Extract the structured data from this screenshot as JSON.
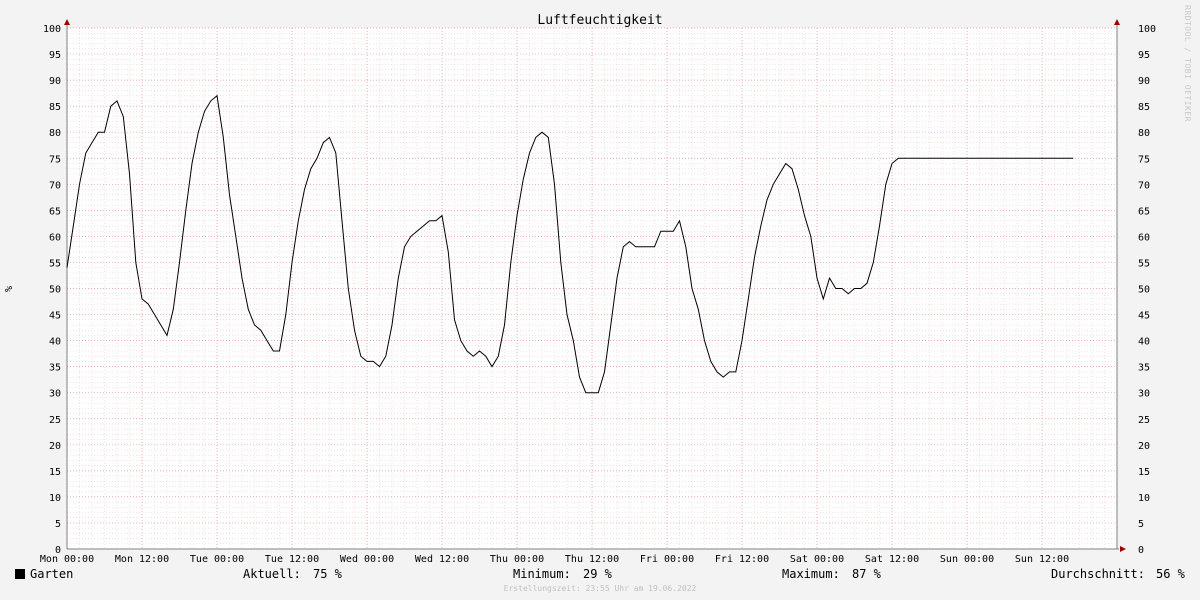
{
  "chart_data": {
    "type": "line",
    "title": "Luftfeuchtigkeit",
    "ylabel": "%",
    "ylim": [
      0,
      100
    ],
    "y_ticks": [
      0,
      5,
      10,
      15,
      20,
      25,
      30,
      35,
      40,
      45,
      50,
      55,
      60,
      65,
      70,
      75,
      80,
      85,
      90,
      95,
      100
    ],
    "x_tick_labels": [
      "Mon 00:00",
      "Mon 12:00",
      "Tue 00:00",
      "Tue 12:00",
      "Wed 00:00",
      "Wed 12:00",
      "Thu 00:00",
      "Thu 12:00",
      "Fri 00:00",
      "Fri 12:00",
      "Sat 00:00",
      "Sat 12:00",
      "Sun 00:00",
      "Sun 12:00"
    ],
    "xlim_hours": [
      0,
      168
    ],
    "grid": true,
    "series": [
      {
        "name": "Garten",
        "color": "#000000",
        "x_hours": [
          0,
          1,
          2,
          3,
          4,
          5,
          6,
          7,
          8,
          9,
          10,
          11,
          12,
          13,
          14,
          15,
          16,
          17,
          18,
          19,
          20,
          21,
          22,
          23,
          24,
          25,
          26,
          27,
          28,
          29,
          30,
          31,
          32,
          33,
          34,
          35,
          36,
          37,
          38,
          39,
          40,
          41,
          42,
          43,
          44,
          45,
          46,
          47,
          48,
          49,
          50,
          51,
          52,
          53,
          54,
          55,
          56,
          57,
          58,
          59,
          60,
          61,
          62,
          63,
          64,
          65,
          66,
          67,
          68,
          69,
          70,
          71,
          72,
          73,
          74,
          75,
          76,
          77,
          78,
          79,
          80,
          81,
          82,
          83,
          84,
          85,
          86,
          87,
          88,
          89,
          90,
          91,
          92,
          93,
          94,
          95,
          96,
          97,
          98,
          99,
          100,
          101,
          102,
          103,
          104,
          105,
          106,
          107,
          108,
          109,
          110,
          111,
          112,
          113,
          114,
          115,
          116,
          117,
          118,
          119,
          120,
          121,
          122,
          123,
          124,
          125,
          126,
          127,
          128,
          129,
          130,
          131,
          132,
          133,
          134,
          135,
          136,
          137,
          138,
          139,
          140,
          141,
          142,
          143,
          144,
          145,
          146,
          147,
          148,
          149,
          150,
          151,
          152,
          153,
          154,
          155,
          156,
          157,
          158,
          159,
          160,
          161,
          162,
          163,
          164,
          165,
          166,
          167,
          168
        ],
        "values": [
          54,
          62,
          70,
          76,
          78,
          80,
          80,
          85,
          86,
          83,
          72,
          55,
          48,
          47,
          45,
          43,
          41,
          46,
          55,
          65,
          74,
          80,
          84,
          86,
          87,
          79,
          68,
          60,
          52,
          46,
          43,
          42,
          40,
          38,
          38,
          45,
          55,
          63,
          69,
          73,
          75,
          78,
          79,
          76,
          63,
          50,
          42,
          37,
          36,
          36,
          35,
          37,
          43,
          52,
          58,
          60,
          61,
          62,
          63,
          63,
          64,
          57,
          44,
          40,
          38,
          37,
          38,
          37,
          35,
          37,
          43,
          55,
          64,
          71,
          76,
          79,
          80,
          79,
          70,
          55,
          45,
          40,
          33,
          30,
          30,
          30,
          34,
          43,
          52,
          58,
          59,
          58,
          58,
          58,
          58,
          61,
          61,
          61,
          63,
          58,
          50,
          46,
          40,
          36,
          34,
          33,
          34,
          34,
          40,
          48,
          56,
          62,
          67,
          70,
          72,
          74,
          73,
          69,
          64,
          60,
          52,
          48,
          52,
          50,
          50,
          49,
          50,
          50,
          51,
          55,
          62,
          70,
          74,
          75,
          75,
          75,
          75,
          75,
          75,
          75,
          75,
          75,
          75,
          75,
          75,
          75,
          75,
          75,
          75,
          75,
          75,
          75,
          75,
          75,
          75,
          75,
          75,
          75,
          75,
          75,
          75,
          75,
          75,
          75,
          75,
          75,
          75,
          75,
          75
        ]
      }
    ]
  },
  "legend": {
    "series_name": "Garten"
  },
  "stats": {
    "current_label": "Aktuell:",
    "current_value": "75 %",
    "min_label": "Minimum:",
    "min_value": "29 %",
    "max_label": "Maximum:",
    "max_value": "87 %",
    "avg_label": "Durchschnitt:",
    "avg_value": "56 %"
  },
  "credit": "Erstellungszeit: 23:55 Uhr am 19.06.2022",
  "watermark": "RRDTOOL / TOBI OETIKER",
  "colors": {
    "grid_minor": "#e8c8c8",
    "grid_major": "#e890a0",
    "axis": "#808080",
    "arrow": "#a00000",
    "line": "#000000"
  }
}
